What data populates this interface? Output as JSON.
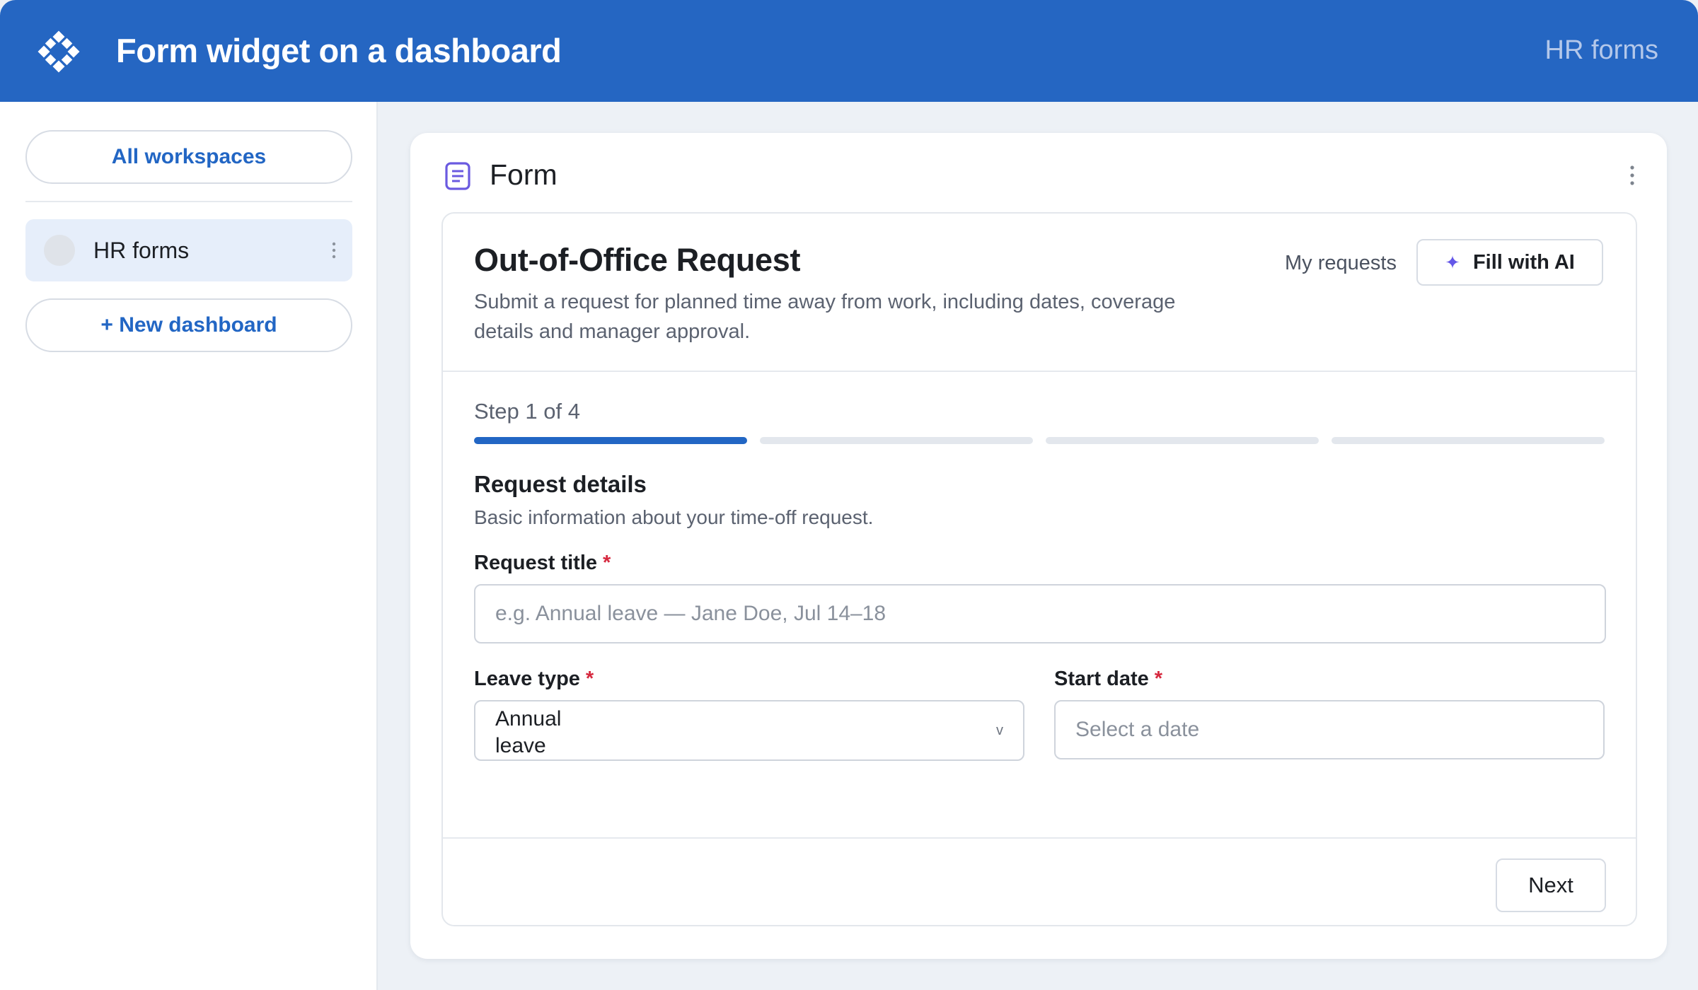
{
  "header": {
    "title": "Form widget on a dashboard",
    "right_label": "HR forms",
    "logo_icon": "diamond-logo-icon"
  },
  "sidebar": {
    "all_workspaces_label": "All workspaces",
    "items": [
      {
        "label": "HR forms",
        "selected": true
      }
    ],
    "new_dashboard_label": "+ New dashboard"
  },
  "widget": {
    "title": "Form",
    "icon": "document-icon"
  },
  "form": {
    "title": "Out-of-Office Request",
    "description": "Submit a request for planned time away from work, including dates, coverage details and manager approval.",
    "my_requests_label": "My requests",
    "fill_ai_label": "Fill with AI",
    "step_text": "Step 1 of 4",
    "steps_total": 4,
    "current_step": 1,
    "section_title": "Request details",
    "section_description": "Basic information about your time-off request.",
    "fields": {
      "request_title": {
        "label": "Request title",
        "required_mark": "*",
        "placeholder": "e.g. Annual leave — Jane Doe, Jul 14–18",
        "value": ""
      },
      "leave_type": {
        "label": "Leave type",
        "required_mark": "*",
        "value": "Annual leave",
        "chevron": "v"
      },
      "start_date": {
        "label": "Start date",
        "required_mark": "*",
        "placeholder": "Select a date",
        "value": ""
      }
    },
    "next_label": "Next"
  },
  "colors": {
    "header_bg": "#2566c2",
    "accent": "#2266c4",
    "required": "#d6283e",
    "sparkle": "#6457e8"
  }
}
